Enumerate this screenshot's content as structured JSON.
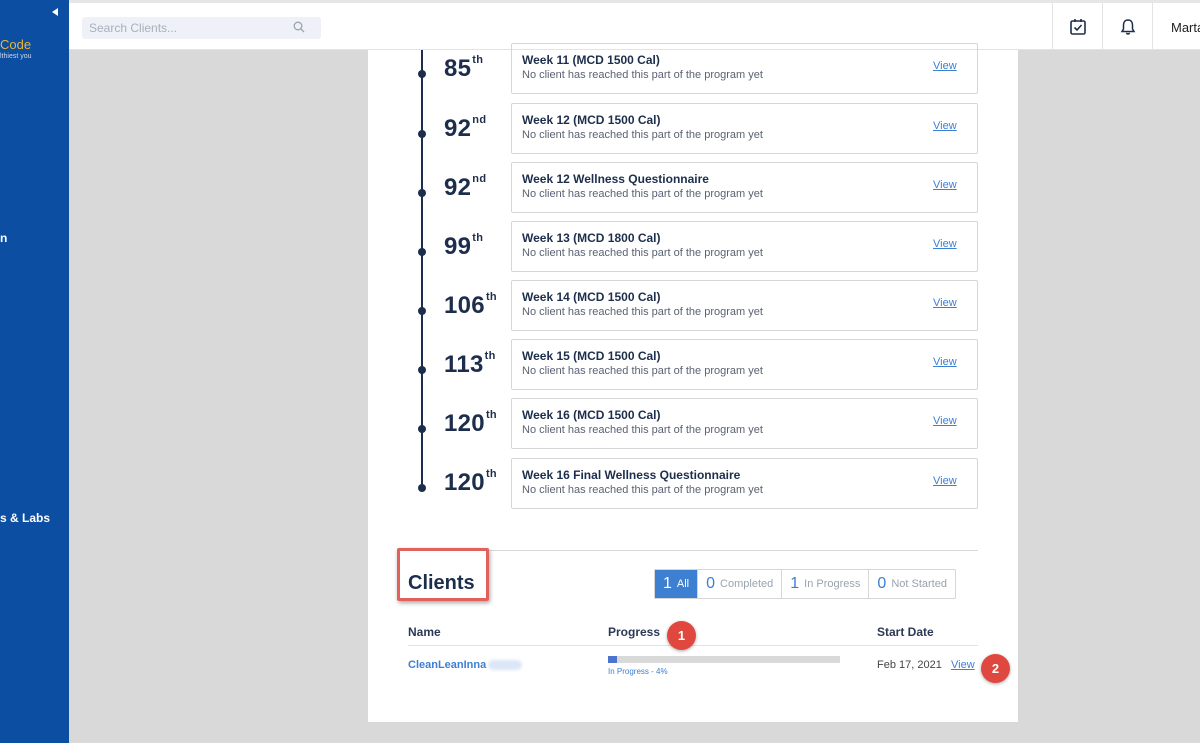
{
  "sidebar": {
    "logo_text": "Code",
    "logo_tagline": "lthiest you",
    "items": [
      {
        "label": "n"
      },
      {
        "label": "s & Labs"
      }
    ]
  },
  "topbar": {
    "search_placeholder": "Search Clients...",
    "user_name": "Marta"
  },
  "timeline": [
    {
      "day": "85",
      "suffix": "th",
      "title": "Week 11 (MCD 1500 Cal)",
      "subtitle": "No client has reached this part of the program yet",
      "action": "View"
    },
    {
      "day": "92",
      "suffix": "nd",
      "title": "Week 12 (MCD 1500 Cal)",
      "subtitle": "No client has reached this part of the program yet",
      "action": "View"
    },
    {
      "day": "92",
      "suffix": "nd",
      "title": "Week 12 Wellness Questionnaire",
      "subtitle": "No client has reached this part of the program yet",
      "action": "View"
    },
    {
      "day": "99",
      "suffix": "th",
      "title": "Week 13 (MCD 1800 Cal)",
      "subtitle": "No client has reached this part of the program yet",
      "action": "View"
    },
    {
      "day": "106",
      "suffix": "th",
      "title": "Week 14 (MCD 1500 Cal)",
      "subtitle": "No client has reached this part of the program yet",
      "action": "View"
    },
    {
      "day": "113",
      "suffix": "th",
      "title": "Week 15 (MCD 1500 Cal)",
      "subtitle": "No client has reached this part of the program yet",
      "action": "View"
    },
    {
      "day": "120",
      "suffix": "th",
      "title": "Week 16 (MCD 1500 Cal)",
      "subtitle": "No client has reached this part of the program yet",
      "action": "View"
    },
    {
      "day": "120",
      "suffix": "th",
      "title": "Week 16 Final Wellness Questionnaire",
      "subtitle": "No client has reached this part of the program yet",
      "action": "View"
    }
  ],
  "clients": {
    "title": "Clients",
    "filters": [
      {
        "count": "1",
        "label": "All",
        "active": true
      },
      {
        "count": "0",
        "label": "Completed",
        "active": false
      },
      {
        "count": "1",
        "label": "In Progress",
        "active": false
      },
      {
        "count": "0",
        "label": "Not Started",
        "active": false
      }
    ],
    "columns": {
      "name": "Name",
      "progress": "Progress",
      "start_date": "Start Date"
    },
    "rows": [
      {
        "name": "CleanLeanInna",
        "progress_fraction": 0.04,
        "status": "In Progress - 4%",
        "start_date": "Feb 17, 2021",
        "action": "View"
      }
    ]
  },
  "annotations": {
    "badge_1": "1",
    "badge_2": "2"
  },
  "colors": {
    "sidebar": "#0b4ea2",
    "accent": "#3d7fd1",
    "badge": "#e0483f",
    "highlight": "#e0625a"
  }
}
